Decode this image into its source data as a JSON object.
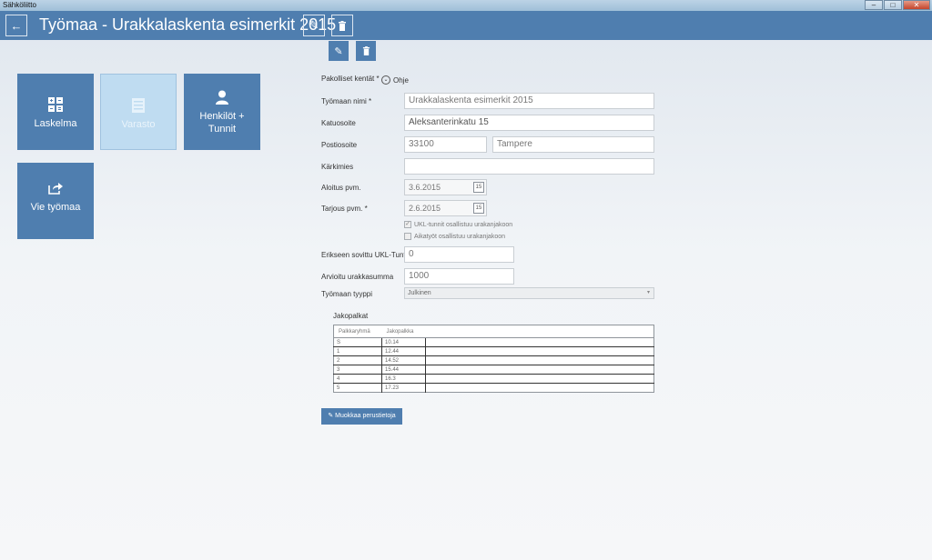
{
  "window": {
    "title": "Sähköliitto",
    "controls": {
      "minimize": "–",
      "maximize": "□",
      "close": "✕"
    }
  },
  "header": {
    "title": "Työmaa - Urakkalaskenta esimerkit 2015",
    "back_icon": "arrow-left-icon",
    "edit_icon": "pencil-icon",
    "delete_icon": "trash-icon",
    "back_glyph": "←",
    "edit_glyph": "✎",
    "delete_glyph": "🗑"
  },
  "tiles": [
    {
      "label": "Laskelma",
      "icon": "calculator-grid-icon"
    },
    {
      "label": "Varasto",
      "icon": "inventory-list-icon"
    },
    {
      "label": "Henkilöt + Tunnit",
      "icon": "person-icon"
    },
    {
      "label": "Vie työmaa",
      "icon": "export-arrow-icon"
    }
  ],
  "form": {
    "required_note": "Pakolliset kentät *",
    "help_label": "Ohje",
    "help_glyph": "⌄",
    "fields": {
      "name": {
        "label": "Työmaan nimi *",
        "value": "Urakkalaskenta esimerkit 2015"
      },
      "street": {
        "label": "Katuosoite",
        "value": "Aleksanterinkatu 15"
      },
      "postal": {
        "label": "Postiosoite",
        "postcode": "33100",
        "city": "Tampere"
      },
      "foreman": {
        "label": "Kärkimies",
        "value": ""
      },
      "start_date": {
        "label": "Aloitus pvm.",
        "value": "3.6.2015"
      },
      "offer_date": {
        "label": "Tarjous pvm. *",
        "value": "2.6.2015"
      },
      "separate_hours": {
        "label": "Erikseen sovittu UKL-Tunti",
        "value": "0"
      },
      "estimate": {
        "label": "Arvioitu urakkasumma",
        "value": "1000"
      },
      "type": {
        "label": "Työmaan tyyppi",
        "value": "Julkinen"
      }
    },
    "checkboxes": [
      {
        "label": "UKL-tunnit osallistuu urakanjakoon",
        "checked": true
      },
      {
        "label": "Aikatyöt osallistuu urakanjakoon",
        "checked": false
      }
    ],
    "calendar_glyph": "15",
    "check_glyph": "✓",
    "select_arrow": "▾"
  },
  "pay_table": {
    "title": "Jakopalkat",
    "headers": [
      "Palkkaryhmä",
      "Jakopalkka"
    ],
    "rows": [
      [
        "S",
        "10.14"
      ],
      [
        "1",
        "12.44"
      ],
      [
        "2",
        "14.52"
      ],
      [
        "3",
        "15.44"
      ],
      [
        "4",
        "16.3"
      ],
      [
        "5",
        "17.23"
      ]
    ]
  },
  "actions": {
    "edit_basic_info": "Muokkaa perustietoja",
    "edit_glyph": "✎"
  },
  "colors": {
    "accent": "#4f7eaf",
    "tile_selected": "#bfdcf1"
  }
}
